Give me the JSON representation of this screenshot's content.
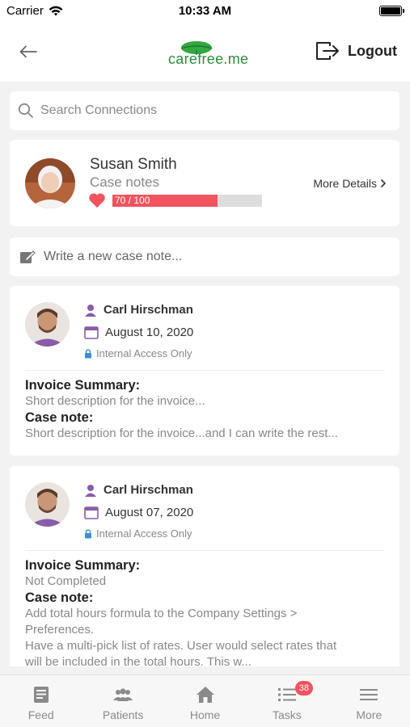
{
  "status_bar": {
    "carrier": "Carrier",
    "time": "10:33 AM"
  },
  "header": {
    "logo_text": "carefree.me",
    "logout_label": "Logout",
    "back_icon": "back-arrow-icon",
    "logout_icon": "logout-icon"
  },
  "search": {
    "placeholder": "Search Connections",
    "value": ""
  },
  "profile": {
    "name": "Susan Smith",
    "subtitle": "Case notes",
    "progress_text": "70 / 100",
    "progress_value": 70,
    "progress_max": 100,
    "more_details_label": "More Details"
  },
  "compose": {
    "label": "Write a new case note..."
  },
  "notes": [
    {
      "author": "Carl Hirschman",
      "date": "August 10, 2020",
      "access": "Internal Access Only",
      "invoice_heading": "Invoice Summary:",
      "invoice_text": "Short description for the invoice...",
      "note_heading": "Case note:",
      "note_lines": [
        "Short description for the invoice...and I can write the rest..."
      ]
    },
    {
      "author": "Carl Hirschman",
      "date": "August 07, 2020",
      "access": "Internal Access Only",
      "invoice_heading": "Invoice Summary:",
      "invoice_text": "Not Completed",
      "note_heading": "Case note:",
      "note_lines": [
        "Add total hours formula to the Company Settings >",
        "Preferences.",
        "Have a multi-pick list of rates. User would select rates that",
        "will be included in the total hours.  This w..."
      ]
    }
  ],
  "tabs": [
    {
      "label": "Feed",
      "icon": "feed-icon"
    },
    {
      "label": "Patients",
      "icon": "patients-icon"
    },
    {
      "label": "Home",
      "icon": "home-icon"
    },
    {
      "label": "Tasks",
      "icon": "tasks-icon",
      "badge": "38"
    },
    {
      "label": "More",
      "icon": "menu-icon"
    }
  ],
  "colors": {
    "accent": "#f0545e",
    "brand_green": "#2e8b3a",
    "icon_purple": "#8a5ca8",
    "lock_blue": "#3b8ed8"
  }
}
